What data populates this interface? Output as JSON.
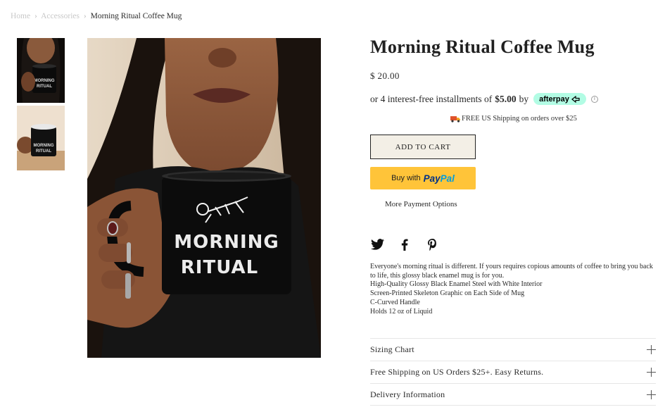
{
  "breadcrumb": {
    "home": "Home",
    "category": "Accessories",
    "separator": "›",
    "current": "Morning Ritual Coffee Mug"
  },
  "gallery": {
    "thumbnails": [
      {
        "alt": "Mug held in hand close-up",
        "selected": true
      },
      {
        "alt": "Mug on table"
      }
    ],
    "main_image_alt": "Person holding black Morning Ritual enamel mug",
    "mug_print_line1": "MORNING",
    "mug_print_line2": "RITUAL"
  },
  "product": {
    "title": "Morning Ritual Coffee Mug",
    "price": "$ 20.00",
    "installments_prefix": "or 4 interest-free installments of",
    "installment_amount": "$5.00",
    "installments_by": "by",
    "afterpay_label": "afterpay",
    "afterpay_color": "#b2fce4",
    "info_symbol": "i",
    "shipping_note": "FREE US Shipping on orders over $25",
    "add_to_cart_label": "ADD TO CART",
    "paypal_prefix": "Buy with",
    "paypal_pay": "Pay",
    "paypal_pal": "Pal",
    "paypal_color": "#ffc439",
    "more_payment_options": "More Payment Options"
  },
  "social": [
    {
      "name": "twitter-icon"
    },
    {
      "name": "facebook-icon"
    },
    {
      "name": "pinterest-icon"
    }
  ],
  "description": {
    "intro": "Everyone's morning ritual is different. If yours requires copious amounts of coffee to bring you back to life, this glossy black enamel mug is for you.",
    "features": [
      "High-Quality Glossy Black Enamel Steel with White Interior",
      "Screen-Printed Skeleton Graphic on Each Side of Mug",
      "C-Curved Handle",
      "Holds 12 oz of Liquid"
    ]
  },
  "accordions": [
    {
      "label": "Sizing Chart"
    },
    {
      "label": "Free Shipping on US Orders $25+. Easy Returns."
    },
    {
      "label": "Delivery Information"
    }
  ]
}
